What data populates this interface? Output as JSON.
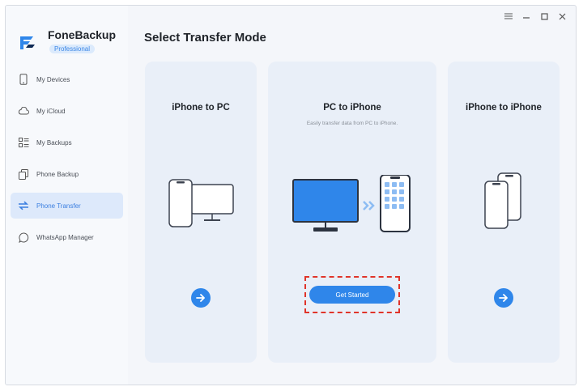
{
  "app": {
    "name": "FoneBackup",
    "badge": "Professional"
  },
  "sidebar": {
    "items": [
      {
        "label": "My Devices",
        "icon": "phone-icon",
        "active": false
      },
      {
        "label": "My iCloud",
        "icon": "cloud-icon",
        "active": false
      },
      {
        "label": "My Backups",
        "icon": "list-icon",
        "active": false
      },
      {
        "label": "Phone Backup",
        "icon": "copy-icon",
        "active": false
      },
      {
        "label": "Phone Transfer",
        "icon": "transfer-icon",
        "active": true
      },
      {
        "label": "WhatsApp Manager",
        "icon": "chat-icon",
        "active": false
      }
    ]
  },
  "window_controls": [
    "menu-icon",
    "minimize-icon",
    "maximize-icon",
    "close-icon"
  ],
  "main": {
    "title": "Select Transfer Mode",
    "cards": [
      {
        "title": "iPhone to PC",
        "subtitle": "",
        "action": "arrow-right-icon"
      },
      {
        "title": "PC to iPhone",
        "subtitle": "Easily transfer data from PC to iPhone.",
        "action_label": "Get Started"
      },
      {
        "title": "iPhone to iPhone",
        "subtitle": "",
        "action": "arrow-right-icon"
      }
    ]
  },
  "colors": {
    "accent": "#2f86ea",
    "sidebar_active_bg": "#dde9fb",
    "card_bg": "#e9eff8",
    "highlight_border": "#e0342a"
  }
}
